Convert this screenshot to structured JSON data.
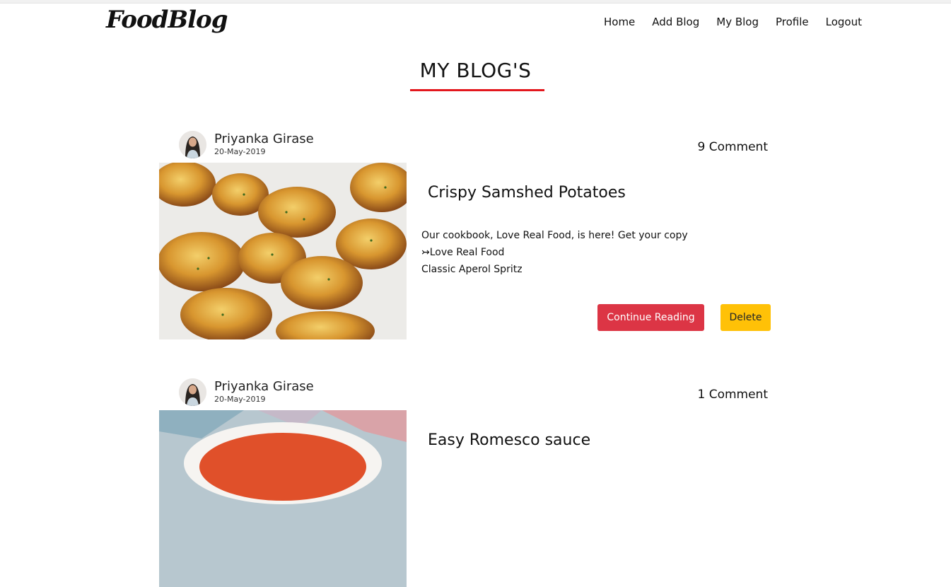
{
  "header": {
    "brand": "FoodBlog",
    "nav": [
      "Home",
      "Add Blog",
      "My Blog",
      "Profile",
      "Logout"
    ]
  },
  "page": {
    "title": "MY BLOG'S",
    "accent_color": "#e3171d"
  },
  "posts": [
    {
      "author": "Priyanka Girase",
      "date": "20-May-2019",
      "comments": "9 Comment",
      "title": "Crispy Samshed Potatoes",
      "excerpt": [
        "Our cookbook, Love Real Food, is here! Get your copy",
        "↣Love Real Food",
        "Classic Aperol Spritz"
      ],
      "continue_label": "Continue Reading",
      "delete_label": "Delete"
    },
    {
      "author": "Priyanka Girase",
      "date": "20-May-2019",
      "comments": "1 Comment",
      "title": "Easy Romesco sauce"
    }
  ],
  "colors": {
    "continue_button": "#dc3545",
    "delete_button": "#ffc107"
  }
}
